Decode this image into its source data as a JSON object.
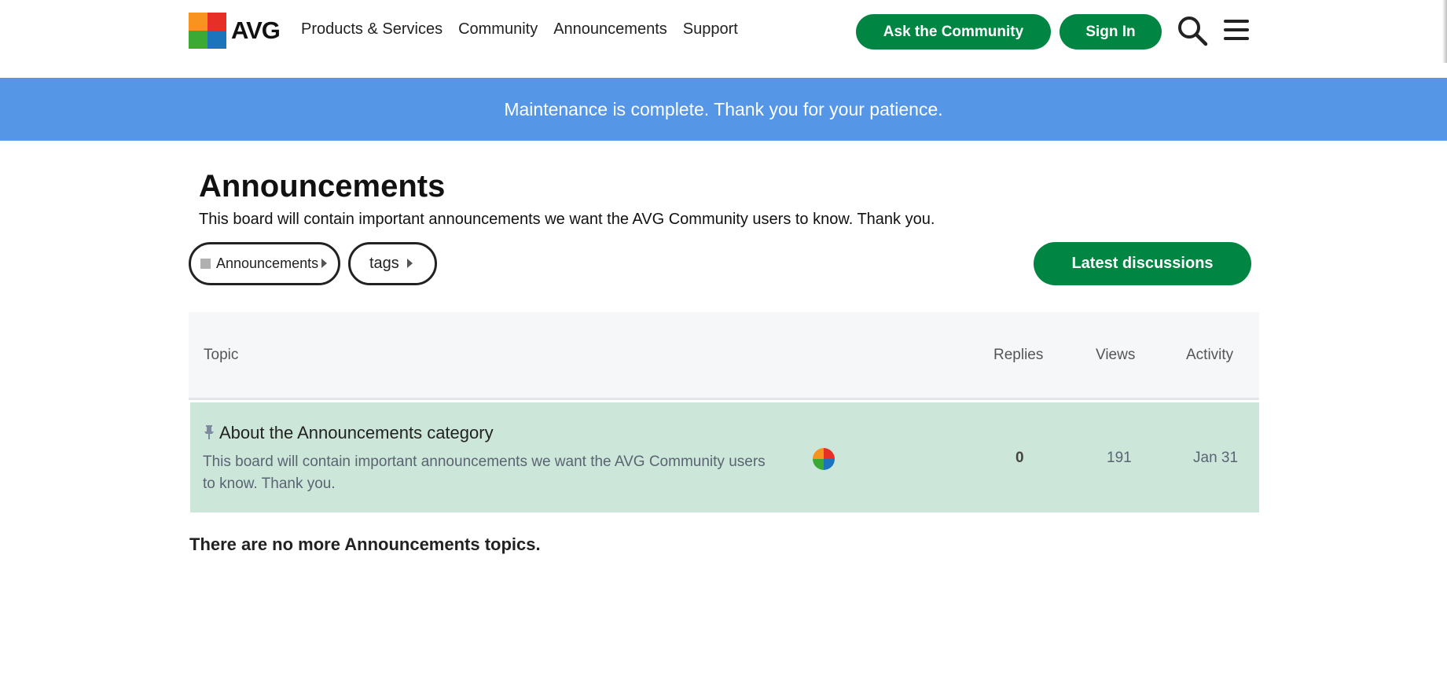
{
  "brand": {
    "logo_text": "AVG",
    "accent": "#008542",
    "banner_color": "#5596e6"
  },
  "nav": {
    "items": [
      {
        "label": "Products & Services"
      },
      {
        "label": "Community"
      },
      {
        "label": "Announcements"
      },
      {
        "label": "Support"
      }
    ],
    "ask_label": "Ask the Community",
    "signin_label": "Sign In",
    "search_icon": "search-icon",
    "menu_icon": "hamburger-menu-icon"
  },
  "banner": {
    "text": "Maintenance is complete. Thank you for your patience."
  },
  "category": {
    "title": "Announcements",
    "description": "This board will contain important announcements we want the AVG Community users to know. Thank you.",
    "filter_category_label": "Announcements",
    "filter_tags_label": "tags",
    "latest_label": "Latest discussions"
  },
  "table": {
    "headers": {
      "topic": "Topic",
      "replies": "Replies",
      "views": "Views",
      "activity": "Activity"
    },
    "rows": [
      {
        "title": "About the Announcements category",
        "excerpt": "This board will contain important announcements we want the AVG Community users to know. Thank you.",
        "replies": "0",
        "views": "191",
        "activity": "Jan 31",
        "pinned": true,
        "row_color": "#cde6da"
      }
    ]
  },
  "footer": {
    "message": "There are no more Announcements topics."
  }
}
